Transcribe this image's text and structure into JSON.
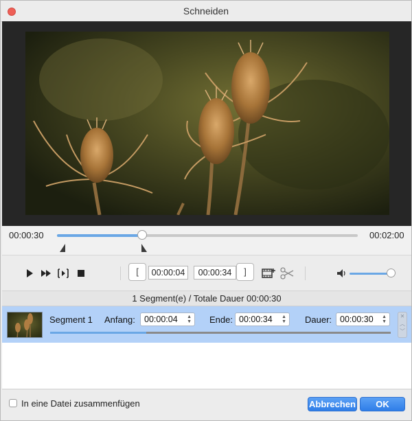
{
  "window": {
    "title": "Schneiden"
  },
  "timeline": {
    "current_time": "00:00:30",
    "total_time": "00:02:00",
    "playhead_fraction": 0.28
  },
  "toolbar": {
    "start_marker": "[",
    "start_time": "00:00:04",
    "end_time": "00:00:34",
    "end_marker": "]",
    "volume_fraction": 1.0
  },
  "summary": {
    "text": "1 Segment(e) / Totale Dauer 00:00:30"
  },
  "segment": {
    "name": "Segment 1",
    "start_label": "Anfang:",
    "start_value": "00:00:04",
    "end_label": "Ende:",
    "end_value": "00:00:34",
    "duration_label": "Dauer:",
    "duration_value": "00:00:30",
    "progress_fraction": 0.28
  },
  "footer": {
    "merge_label": "In eine Datei zusammenfügen",
    "merge_checked": false,
    "cancel_label": "Abbrechen",
    "ok_label": "OK"
  },
  "colors": {
    "accent": "#6aa7e5",
    "selection": "#b3d1f8",
    "button": "#2f7ee8",
    "close": "#ee5f56"
  }
}
